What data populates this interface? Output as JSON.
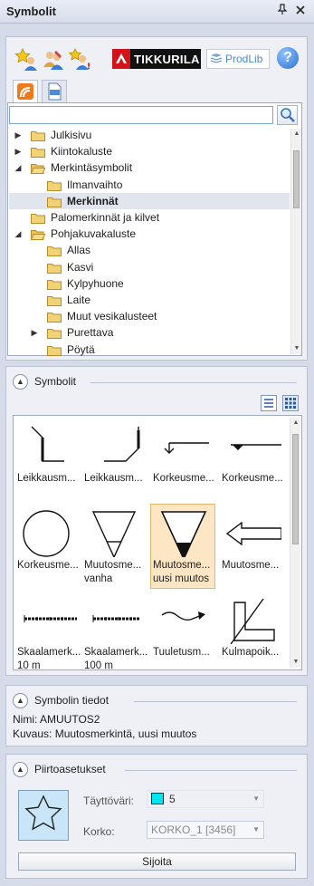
{
  "window": {
    "title": "Symbolit",
    "pin_icon": "pin-icon",
    "close_icon": "close-icon"
  },
  "toolbar": {
    "icons": [
      "user-star-icon",
      "users-edit-icon",
      "user-warning-icon"
    ],
    "tikkurila_label": "TIKKURILA",
    "prodlib_label": "ProdLib",
    "help_label": "?"
  },
  "tree": {
    "search_placeholder": "",
    "items": [
      {
        "label": "Julkisivu",
        "level": 0,
        "expander": "collapsed",
        "open": false,
        "selected": false
      },
      {
        "label": "Kiintokaluste",
        "level": 0,
        "expander": "collapsed",
        "open": false,
        "selected": false
      },
      {
        "label": "Merkintäsymbolit",
        "level": 0,
        "expander": "expanded",
        "open": true,
        "selected": false
      },
      {
        "label": "Ilmanvaihto",
        "level": 1,
        "expander": "none",
        "open": false,
        "selected": false
      },
      {
        "label": "Merkinnät",
        "level": 1,
        "expander": "none",
        "open": false,
        "selected": true
      },
      {
        "label": "Palomerkinnät ja kilvet",
        "level": 0,
        "expander": "none",
        "open": false,
        "selected": false
      },
      {
        "label": "Pohjakuvakaluste",
        "level": 0,
        "expander": "expanded",
        "open": true,
        "selected": false
      },
      {
        "label": "Allas",
        "level": 1,
        "expander": "none",
        "open": false,
        "selected": false
      },
      {
        "label": "Kasvi",
        "level": 1,
        "expander": "none",
        "open": false,
        "selected": false
      },
      {
        "label": "Kylpyhuone",
        "level": 1,
        "expander": "none",
        "open": false,
        "selected": false
      },
      {
        "label": "Laite",
        "level": 1,
        "expander": "none",
        "open": false,
        "selected": false
      },
      {
        "label": "Muut vesikalusteet",
        "level": 1,
        "expander": "none",
        "open": false,
        "selected": false
      },
      {
        "label": "Purettava",
        "level": 1,
        "expander": "collapsed",
        "open": false,
        "selected": false
      },
      {
        "label": "Pöytä",
        "level": 1,
        "expander": "none",
        "open": false,
        "selected": false
      }
    ]
  },
  "symbols_section": {
    "title": "Symbolit",
    "items": [
      {
        "caption": "Leikkausm...",
        "icon": "section-mark-left-icon",
        "selected": false
      },
      {
        "caption": "Leikkausm...",
        "icon": "section-mark-right-icon",
        "selected": false
      },
      {
        "caption": "Korkeusme...",
        "icon": "level-mark-arrow-icon",
        "selected": false
      },
      {
        "caption": "Korkeusme...",
        "icon": "level-mark-triangle-icon",
        "selected": false
      },
      {
        "caption": "Korkeusme...",
        "icon": "level-mark-circle-icon",
        "selected": false
      },
      {
        "caption": "Muutosme... vanha",
        "icon": "revision-old-icon",
        "selected": false
      },
      {
        "caption": "Muutosme... uusi muutos",
        "icon": "revision-new-icon",
        "selected": true
      },
      {
        "caption": "Muutosme...",
        "icon": "revision-arrow-icon",
        "selected": false
      },
      {
        "caption": "Skaalamerk... 10 m",
        "icon": "scale-bar-10-icon",
        "selected": false
      },
      {
        "caption": "Skaalamerk... 100 m",
        "icon": "scale-bar-100-icon",
        "selected": false
      },
      {
        "caption": "Tuuletusm...",
        "icon": "ventilation-mark-icon",
        "selected": false
      },
      {
        "caption": "Kulmapoik...",
        "icon": "corner-section-icon",
        "selected": false
      }
    ]
  },
  "details": {
    "title": "Symbolin tiedot",
    "name_label": "Nimi:",
    "name_value": "AMUUTOS2",
    "desc_label": "Kuvaus:",
    "desc_value": "Muutosmerkintä, uusi muutos"
  },
  "draw_settings": {
    "title": "Piirtoasetukset",
    "fill_label": "Täyttöväri:",
    "fill_value": "5",
    "fill_color": "#00e5f0",
    "height_label": "Korko:",
    "height_value": "KORKO_1 [3456]",
    "place_button": "Sijoita"
  }
}
